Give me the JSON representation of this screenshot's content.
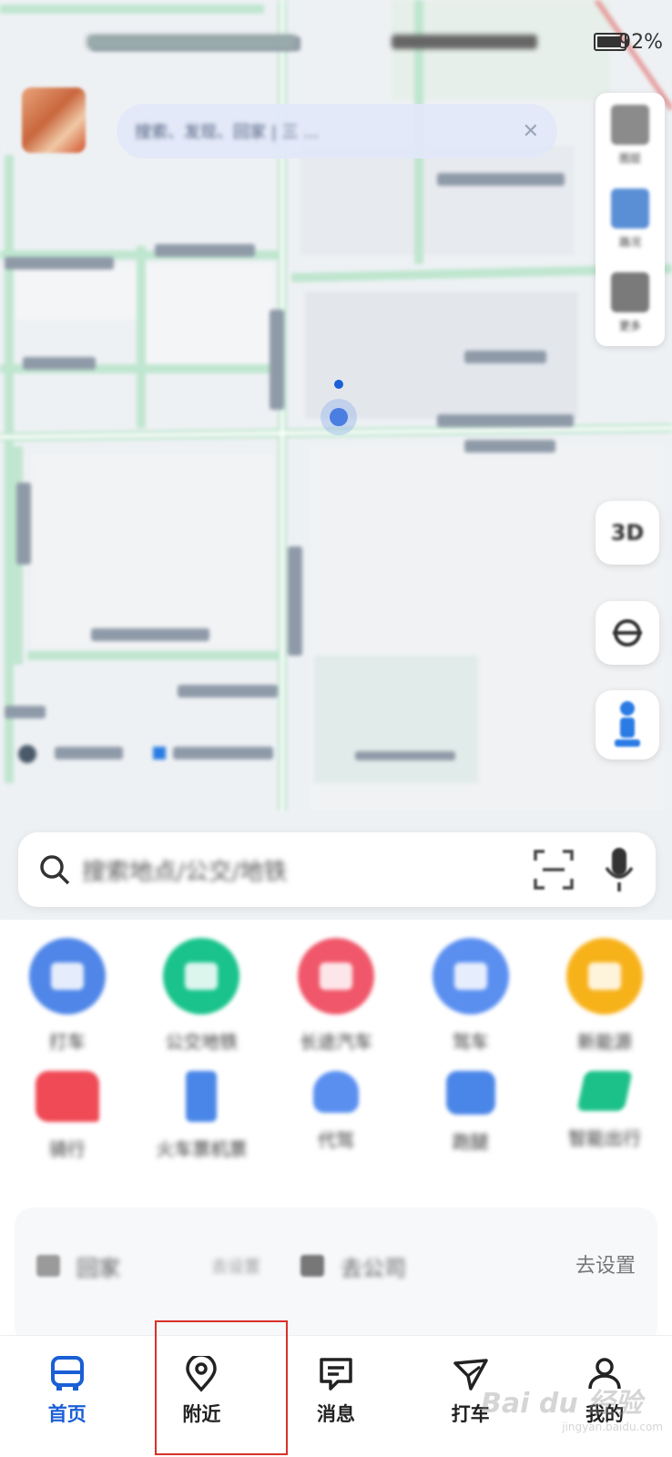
{
  "status_bar": {
    "battery_level": 0.92,
    "battery_pct": "92%"
  },
  "top_search": {
    "placeholder": "搜索、发现、回家 | 三 ...",
    "close": "✕"
  },
  "map_controls": {
    "right_items": [
      {
        "label": "图层",
        "icon": "layers-icon",
        "color": "#8b8b8b"
      },
      {
        "label": "路况",
        "icon": "avatar-icon",
        "color": "#5a8fd6"
      },
      {
        "label": "更多",
        "icon": "grid-icon",
        "color": "#7a7a7a"
      }
    ],
    "btn_3d": "3D"
  },
  "search_card": {
    "placeholder": "搜索地点/公交/地铁"
  },
  "services_row1": [
    {
      "label": "打车",
      "color": "#4f86e8",
      "icon": "car-icon"
    },
    {
      "label": "公交地铁",
      "color": "#19c38b",
      "icon": "bus-icon"
    },
    {
      "label": "长途汽车",
      "color": "#f0576a",
      "icon": "ticket-icon"
    },
    {
      "label": "驾车",
      "color": "#5a8ff0",
      "icon": "route-icon"
    },
    {
      "label": "新能源",
      "color": "#f7b21a",
      "icon": "charging-icon"
    }
  ],
  "services_row2": [
    {
      "label": "骑行",
      "color": "#ef4a55",
      "icon": "badge-icon"
    },
    {
      "label": "火车票机票",
      "color": "#4a86e8",
      "icon": "phone-icon"
    },
    {
      "label": "代驾",
      "color": "#5a8ff0",
      "icon": "helmet-icon"
    },
    {
      "label": "跑腿",
      "color": "#4a86e8",
      "icon": "flag-icon"
    },
    {
      "label": "智能出行",
      "color": "#1cc18a",
      "icon": "speed-icon"
    }
  ],
  "commute": {
    "home_label": "回家",
    "home_hint": "去设置",
    "work_label": "去公司",
    "go_setup": "去设置"
  },
  "nav": [
    {
      "label": "首页",
      "icon": "bus-icon",
      "active": true
    },
    {
      "label": "附近",
      "icon": "location-pin-icon",
      "active": false
    },
    {
      "label": "消息",
      "icon": "message-icon",
      "active": false
    },
    {
      "label": "打车",
      "icon": "taxi-icon",
      "active": false
    },
    {
      "label": "我的",
      "icon": "profile-icon",
      "active": false
    }
  ],
  "watermark": {
    "brand": "Bai du 经验",
    "url": "jingyan.baidu.com"
  }
}
